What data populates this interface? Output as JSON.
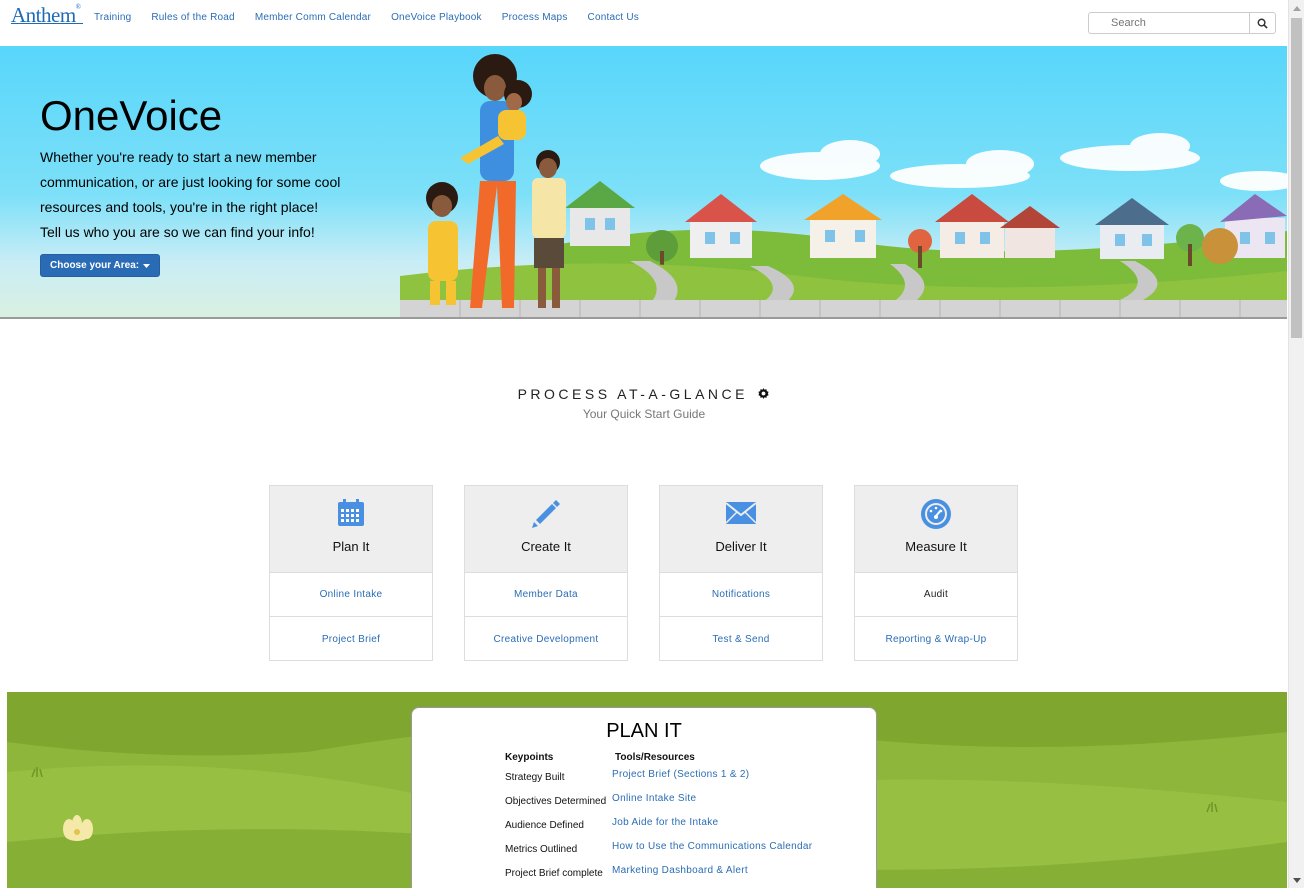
{
  "nav": {
    "logo": "Anthem",
    "logo_mark": "®",
    "links": [
      "Training",
      "Rules of the Road",
      "Member Comm Calendar",
      "OneVoice Playbook",
      "Process Maps",
      "Contact Us"
    ],
    "search_placeholder": "Search"
  },
  "hero": {
    "title": "OneVoice",
    "lines": [
      "Whether you're ready to start a new member",
      "communication, or are just looking for some cool",
      "resources and tools, you're in the right place!",
      "Tell us who you are so we can find your info!"
    ],
    "button_label": "Choose your Area:"
  },
  "process": {
    "title": "PROCESS AT-A-GLANCE",
    "subtitle": "Your Quick Start Guide",
    "cards": [
      {
        "label": "Plan It",
        "icon": "calendar-icon",
        "links": [
          "Online Intake",
          "Project Brief"
        ]
      },
      {
        "label": "Create It",
        "icon": "pencil-icon",
        "links": [
          "Member Data",
          "Creative Development"
        ]
      },
      {
        "label": "Deliver It",
        "icon": "envelope-icon",
        "links": [
          "Notifications",
          "Test & Send"
        ]
      },
      {
        "label": "Measure It",
        "icon": "dashboard-icon",
        "links": [
          "Audit",
          "Reporting & Wrap-Up"
        ]
      }
    ]
  },
  "plan_it": {
    "title": "PLAN IT",
    "keypoints_header": "Keypoints",
    "tools_header": "Tools/Resources",
    "keypoints": [
      "Strategy Built",
      "Objectives Determined",
      "Audience Defined",
      "Metrics Outlined",
      "Project Brief complete"
    ],
    "tools": [
      "Project Brief (Sections 1 & 2)",
      "Online Intake Site",
      "Job Aide for the Intake",
      "How to Use the Communications Calendar",
      "Marketing Dashboard & Alert"
    ]
  },
  "colors": {
    "accent": "#2a6db5",
    "button": "#2a6bb6",
    "icon": "#4a90e2",
    "grass": "#8db63a"
  }
}
